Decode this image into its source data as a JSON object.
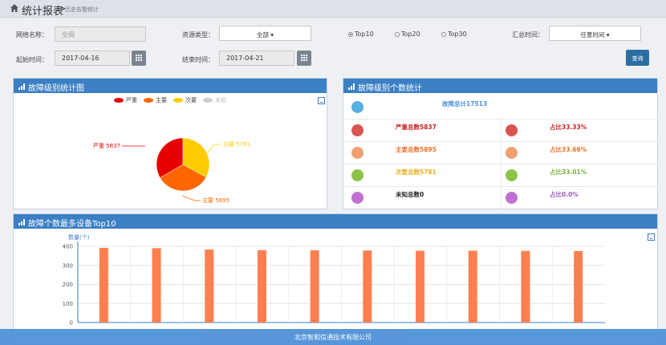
{
  "header": {
    "title": "统计报表",
    "separator": ">",
    "subtitle": "历史告警统计"
  },
  "filters": {
    "network_label": "网络名称：",
    "network_value": "全网",
    "resource_label": "资源类型：",
    "resource_value": "全部 ▾",
    "top_options": [
      {
        "label": "Top10",
        "selected": true
      },
      {
        "label": "Top20",
        "selected": false
      },
      {
        "label": "Top30",
        "selected": false
      }
    ],
    "summary_time_label": "汇总时间：",
    "summary_time_value": "任意时间 ▾",
    "start_label": "起始时间：",
    "start_value": "2017-04-16",
    "end_label": "结束时间：",
    "end_value": "2017-04-21",
    "query_button": "查询"
  },
  "pie_panel": {
    "title": "故障级别统计图",
    "legend": [
      {
        "name": "严重",
        "color": "#e60000"
      },
      {
        "name": "主要",
        "color": "#ff6600"
      },
      {
        "name": "次要",
        "color": "#ffcc00"
      },
      {
        "name": "未知",
        "color": "#cccccc"
      }
    ],
    "labels": {
      "severe": "严重 5837",
      "major": "主要 5895",
      "minor": "次要 5781"
    }
  },
  "chart_data": [
    {
      "type": "pie",
      "title": "故障级别统计图",
      "categories": [
        "严重",
        "主要",
        "次要",
        "未知"
      ],
      "values": [
        5837,
        5895,
        5781,
        0
      ],
      "colors": [
        "#e60000",
        "#ff6600",
        "#ffcc00",
        "#cccccc"
      ],
      "legend": "top"
    },
    {
      "type": "bar",
      "title": "故障个数最多设备Top10",
      "ylabel": "数量(个)",
      "ylim": [
        0,
        400
      ],
      "yticks": [
        0,
        100,
        200,
        300,
        400
      ],
      "values": [
        392,
        390,
        383,
        380,
        379,
        378,
        377,
        377,
        376,
        375
      ],
      "color": "#ff7f50"
    }
  ],
  "count_panel": {
    "title": "故障级别个数统计",
    "total": "故障总计17513",
    "rows": [
      {
        "left": "严重总数5837",
        "right": "占比33.33%",
        "color": "#cc2222",
        "icon": "chat-icon",
        "icon_color": "#d9534f"
      },
      {
        "left": "主要总数5895",
        "right": "占比33.66%",
        "color": "#e8722a",
        "icon": "cart-icon",
        "icon_color": "#f0a070"
      },
      {
        "left": "次要总数5781",
        "right": "占比33.01%",
        "color": "#e8b020",
        "icon": "flask-icon",
        "icon_color": "#8bc34a"
      },
      {
        "left": "未知总数0",
        "right": "占比0.0%",
        "color": "#222222",
        "right_color": "#9b59b6",
        "icon": "flask-icon",
        "icon_color": "#c070d0"
      }
    ]
  },
  "bar_panel": {
    "title": "故障个数最多设备Top10",
    "ylabel": "数量(个)"
  },
  "footer": {
    "text": "北京智和信通技术有限公司"
  }
}
